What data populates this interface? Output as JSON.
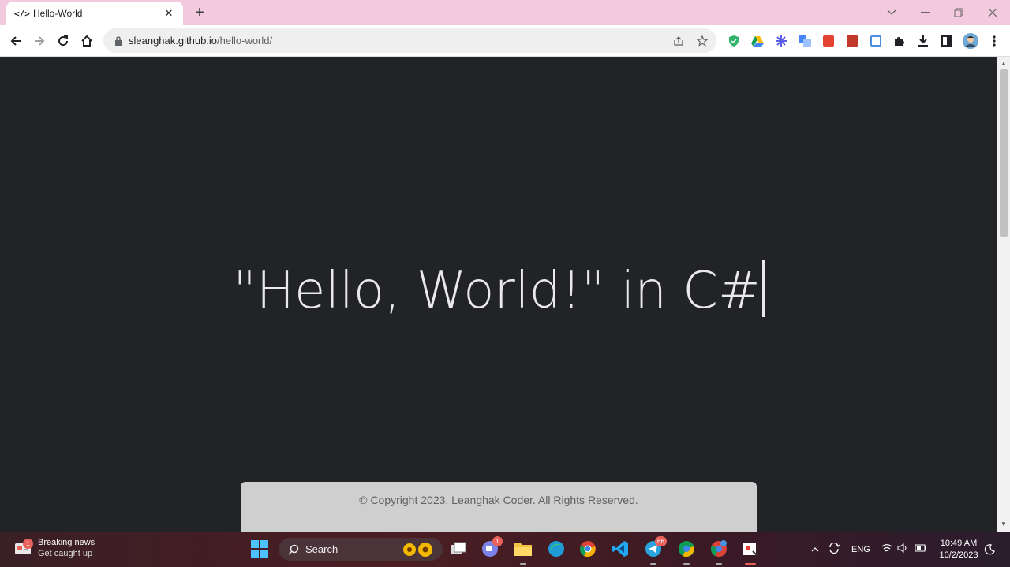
{
  "browser": {
    "tab": {
      "favicon": "</>",
      "title": "Hello-World",
      "close": "✕"
    },
    "new_tab": "+",
    "url": {
      "host": "sleanghak.github.io",
      "path": "/hello-world/"
    }
  },
  "page": {
    "headline": "\"Hello, World!\" in C#",
    "footer": "© Copyright 2023, Leanghak Coder. All Rights Reserved."
  },
  "taskbar": {
    "news_title": "Breaking news",
    "news_subtitle": "Get caught up",
    "news_badge": "1",
    "search_label": "Search",
    "teams_badge": "1",
    "telegram_badge": "66",
    "language": "ENG",
    "time": "10:49 AM",
    "date": "10/2/2023"
  },
  "colors": {
    "accent_pink": "#f3c9dd",
    "page_bg": "#212327",
    "footer_bg": "#cfcfcf"
  }
}
